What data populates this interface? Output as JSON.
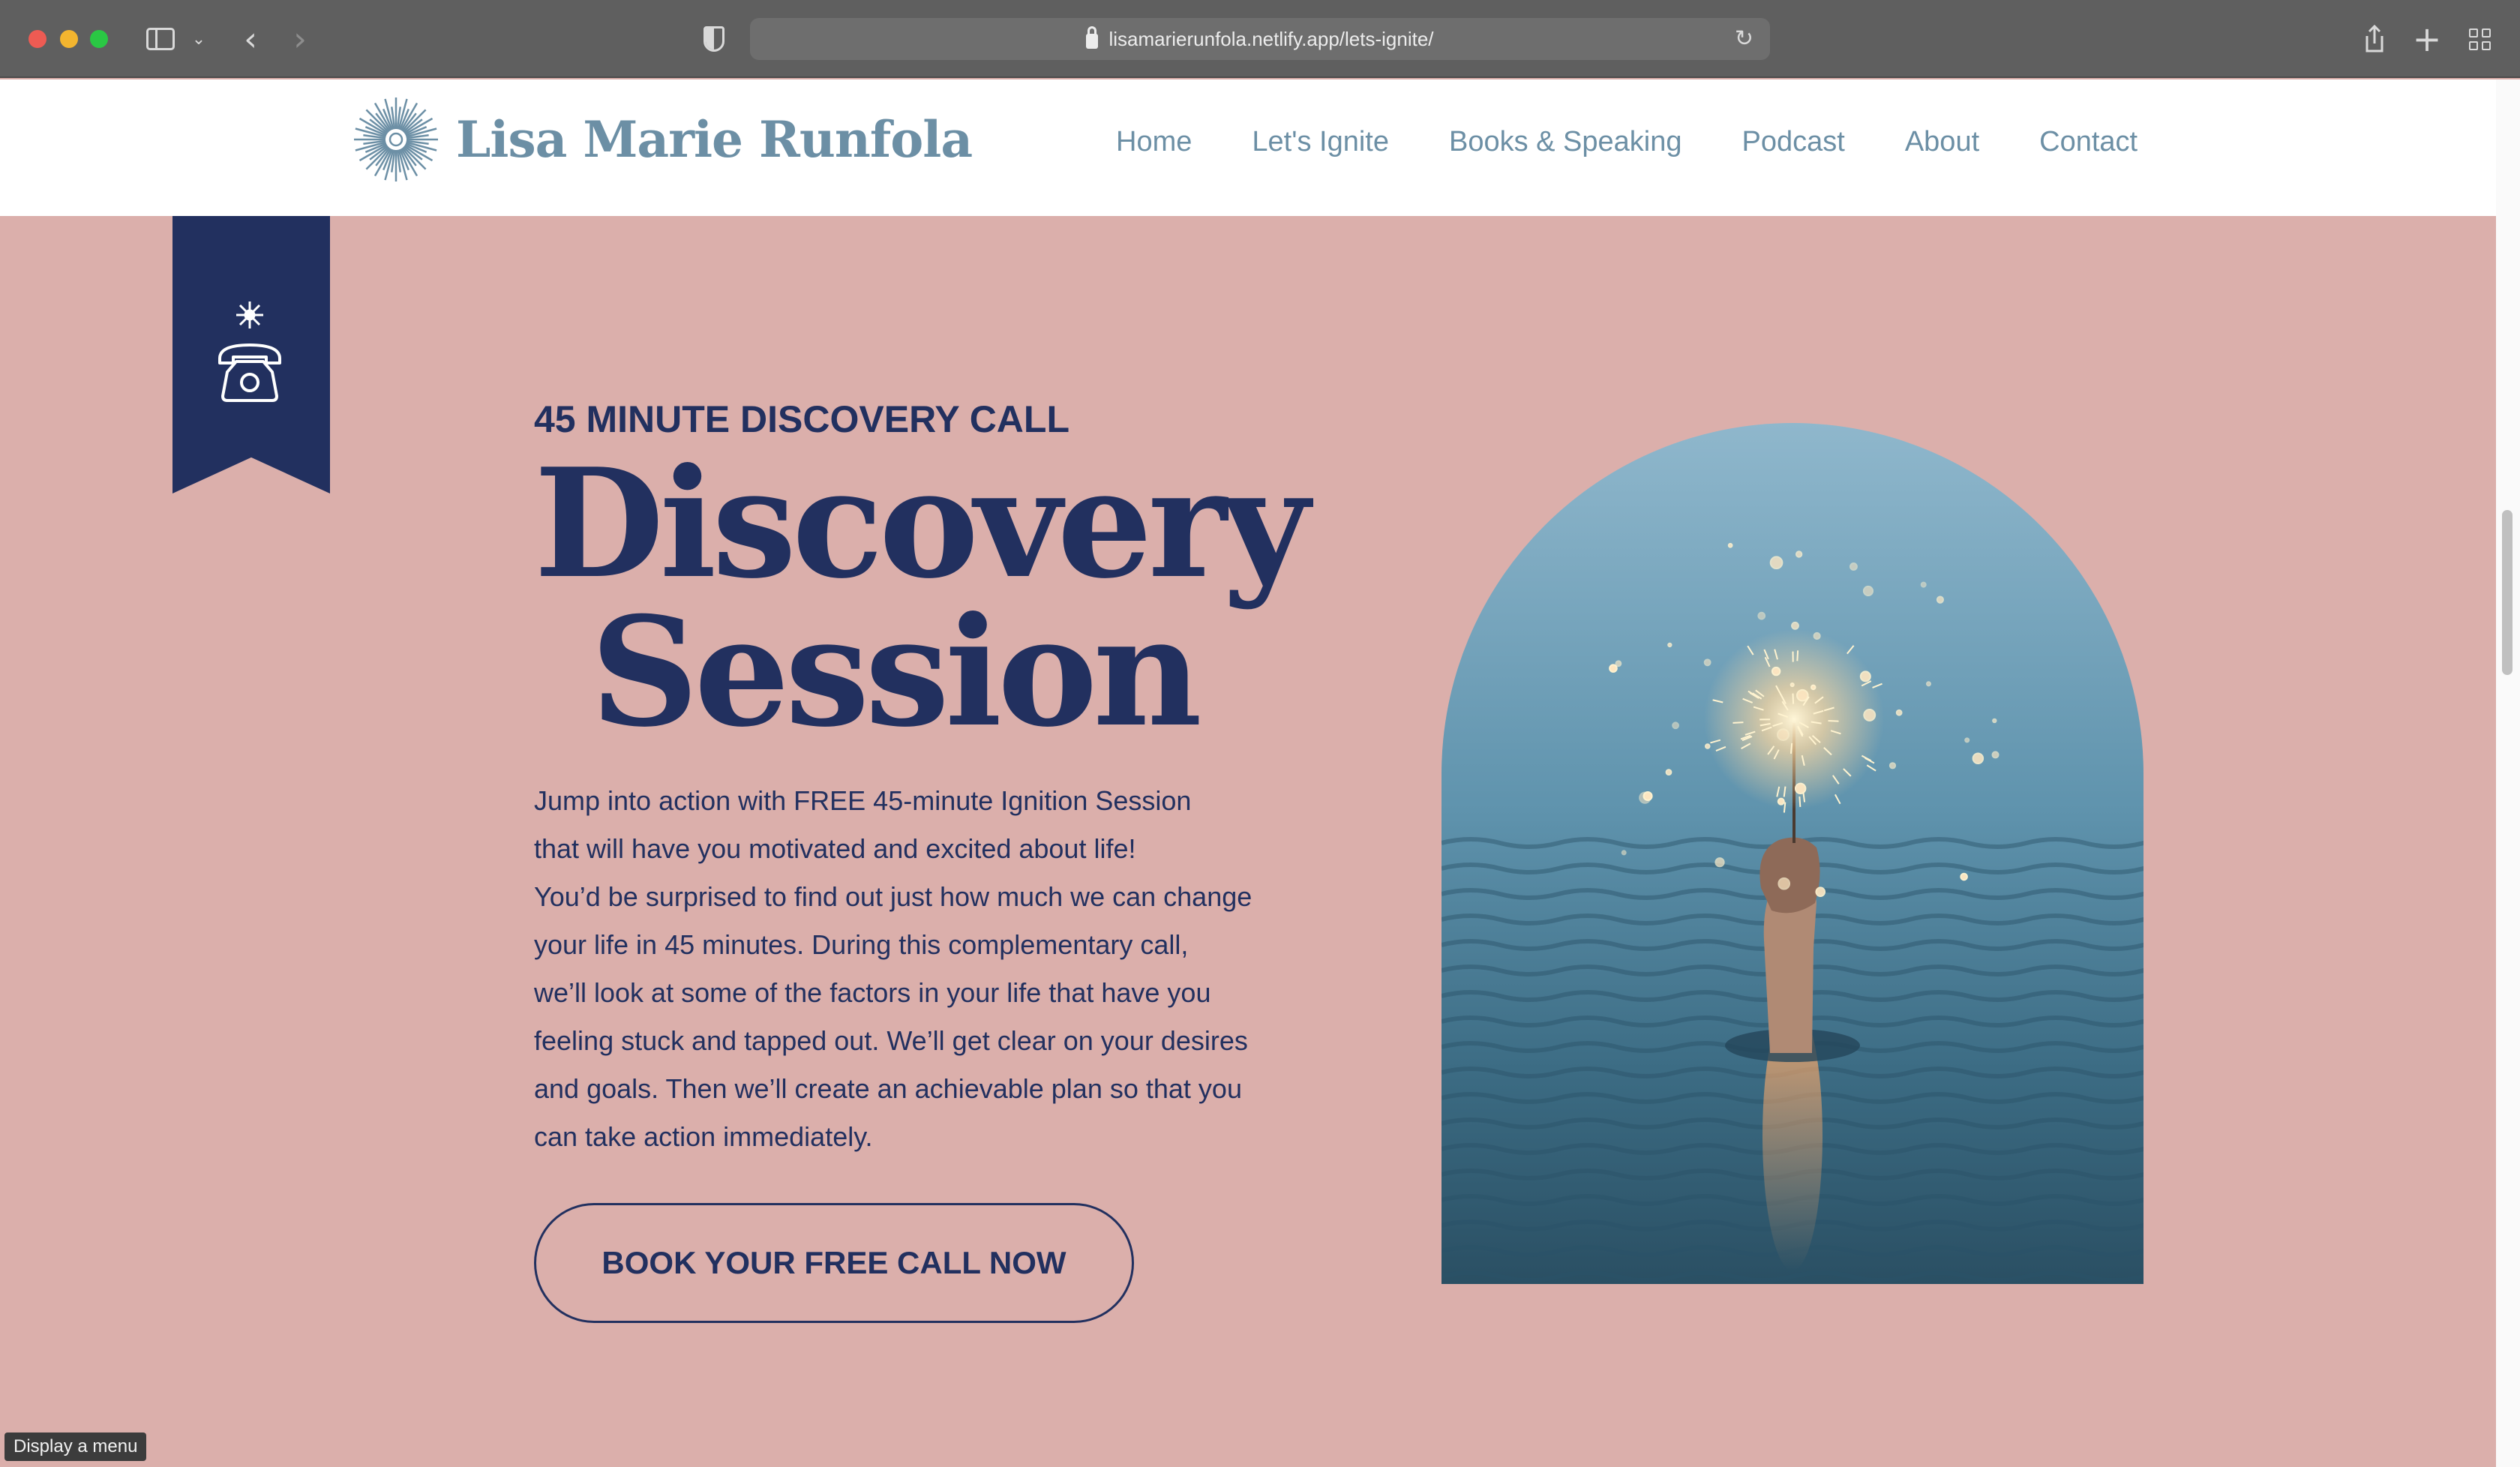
{
  "browser": {
    "url": "lisamarierunfola.netlify.app/lets-ignite/"
  },
  "site": {
    "logo_text": "Lisa Marie Runfola",
    "nav": [
      "Home",
      "Let's Ignite",
      "Books & Speaking",
      "Podcast",
      "About",
      "Contact"
    ]
  },
  "ribbon": {
    "icons": [
      "sparkle-icon",
      "telephone-icon"
    ]
  },
  "hero": {
    "eyebrow": "45 MINUTE DISCOVERY CALL",
    "title_line1": "Discovery",
    "title_line2": "Session",
    "paragraph1_line1": "Jump into action with FREE 45-minute Ignition Session",
    "paragraph1_line2": "that will have you motivated and excited about life!",
    "paragraph2_lines": [
      "You’d be surprised to find out just how much we can change",
      "your life in 45 minutes. During this complementary call,",
      "we’ll look at some of the factors in your life that have you",
      "feeling stuck and tapped out. We’ll get clear on your desires",
      "and goals. Then we’ll create an achievable plan so that you",
      "can take action immediately."
    ],
    "cta_label": "BOOK YOUR FREE CALL NOW"
  },
  "tooltip": "Display a menu",
  "colors": {
    "background": "#dbafab",
    "navy": "#22305f",
    "brand_blue": "#6c8fa5"
  }
}
